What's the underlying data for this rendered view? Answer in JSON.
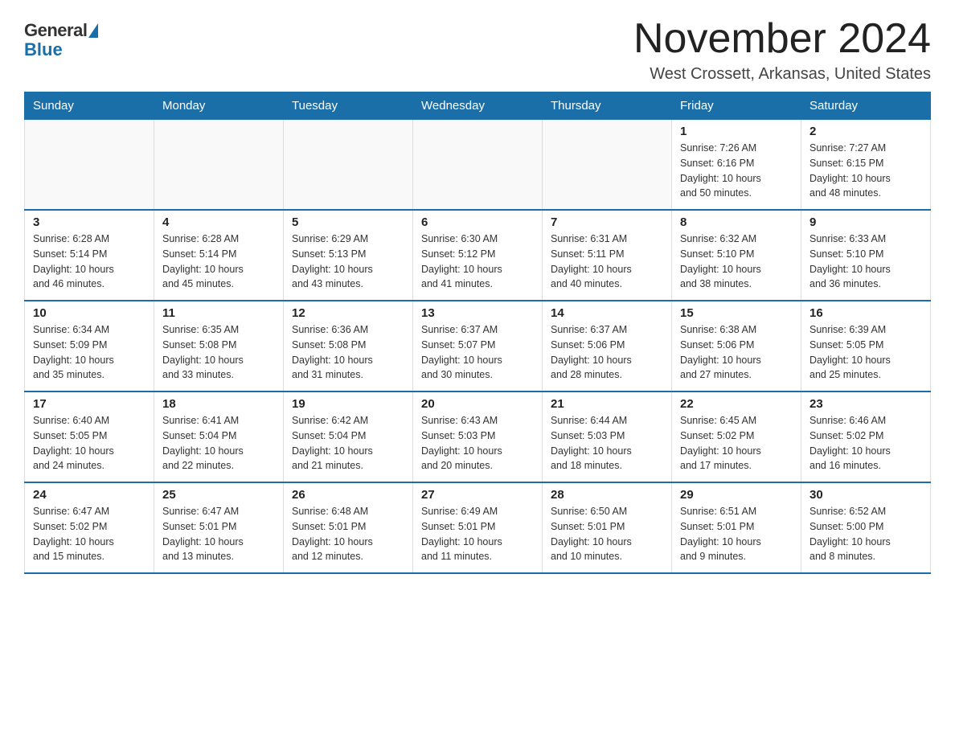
{
  "logo": {
    "general": "General",
    "blue": "Blue"
  },
  "title": "November 2024",
  "location": "West Crossett, Arkansas, United States",
  "days_of_week": [
    "Sunday",
    "Monday",
    "Tuesday",
    "Wednesday",
    "Thursday",
    "Friday",
    "Saturday"
  ],
  "weeks": [
    [
      {
        "day": "",
        "info": ""
      },
      {
        "day": "",
        "info": ""
      },
      {
        "day": "",
        "info": ""
      },
      {
        "day": "",
        "info": ""
      },
      {
        "day": "",
        "info": ""
      },
      {
        "day": "1",
        "info": "Sunrise: 7:26 AM\nSunset: 6:16 PM\nDaylight: 10 hours\nand 50 minutes."
      },
      {
        "day": "2",
        "info": "Sunrise: 7:27 AM\nSunset: 6:15 PM\nDaylight: 10 hours\nand 48 minutes."
      }
    ],
    [
      {
        "day": "3",
        "info": "Sunrise: 6:28 AM\nSunset: 5:14 PM\nDaylight: 10 hours\nand 46 minutes."
      },
      {
        "day": "4",
        "info": "Sunrise: 6:28 AM\nSunset: 5:14 PM\nDaylight: 10 hours\nand 45 minutes."
      },
      {
        "day": "5",
        "info": "Sunrise: 6:29 AM\nSunset: 5:13 PM\nDaylight: 10 hours\nand 43 minutes."
      },
      {
        "day": "6",
        "info": "Sunrise: 6:30 AM\nSunset: 5:12 PM\nDaylight: 10 hours\nand 41 minutes."
      },
      {
        "day": "7",
        "info": "Sunrise: 6:31 AM\nSunset: 5:11 PM\nDaylight: 10 hours\nand 40 minutes."
      },
      {
        "day": "8",
        "info": "Sunrise: 6:32 AM\nSunset: 5:10 PM\nDaylight: 10 hours\nand 38 minutes."
      },
      {
        "day": "9",
        "info": "Sunrise: 6:33 AM\nSunset: 5:10 PM\nDaylight: 10 hours\nand 36 minutes."
      }
    ],
    [
      {
        "day": "10",
        "info": "Sunrise: 6:34 AM\nSunset: 5:09 PM\nDaylight: 10 hours\nand 35 minutes."
      },
      {
        "day": "11",
        "info": "Sunrise: 6:35 AM\nSunset: 5:08 PM\nDaylight: 10 hours\nand 33 minutes."
      },
      {
        "day": "12",
        "info": "Sunrise: 6:36 AM\nSunset: 5:08 PM\nDaylight: 10 hours\nand 31 minutes."
      },
      {
        "day": "13",
        "info": "Sunrise: 6:37 AM\nSunset: 5:07 PM\nDaylight: 10 hours\nand 30 minutes."
      },
      {
        "day": "14",
        "info": "Sunrise: 6:37 AM\nSunset: 5:06 PM\nDaylight: 10 hours\nand 28 minutes."
      },
      {
        "day": "15",
        "info": "Sunrise: 6:38 AM\nSunset: 5:06 PM\nDaylight: 10 hours\nand 27 minutes."
      },
      {
        "day": "16",
        "info": "Sunrise: 6:39 AM\nSunset: 5:05 PM\nDaylight: 10 hours\nand 25 minutes."
      }
    ],
    [
      {
        "day": "17",
        "info": "Sunrise: 6:40 AM\nSunset: 5:05 PM\nDaylight: 10 hours\nand 24 minutes."
      },
      {
        "day": "18",
        "info": "Sunrise: 6:41 AM\nSunset: 5:04 PM\nDaylight: 10 hours\nand 22 minutes."
      },
      {
        "day": "19",
        "info": "Sunrise: 6:42 AM\nSunset: 5:04 PM\nDaylight: 10 hours\nand 21 minutes."
      },
      {
        "day": "20",
        "info": "Sunrise: 6:43 AM\nSunset: 5:03 PM\nDaylight: 10 hours\nand 20 minutes."
      },
      {
        "day": "21",
        "info": "Sunrise: 6:44 AM\nSunset: 5:03 PM\nDaylight: 10 hours\nand 18 minutes."
      },
      {
        "day": "22",
        "info": "Sunrise: 6:45 AM\nSunset: 5:02 PM\nDaylight: 10 hours\nand 17 minutes."
      },
      {
        "day": "23",
        "info": "Sunrise: 6:46 AM\nSunset: 5:02 PM\nDaylight: 10 hours\nand 16 minutes."
      }
    ],
    [
      {
        "day": "24",
        "info": "Sunrise: 6:47 AM\nSunset: 5:02 PM\nDaylight: 10 hours\nand 15 minutes."
      },
      {
        "day": "25",
        "info": "Sunrise: 6:47 AM\nSunset: 5:01 PM\nDaylight: 10 hours\nand 13 minutes."
      },
      {
        "day": "26",
        "info": "Sunrise: 6:48 AM\nSunset: 5:01 PM\nDaylight: 10 hours\nand 12 minutes."
      },
      {
        "day": "27",
        "info": "Sunrise: 6:49 AM\nSunset: 5:01 PM\nDaylight: 10 hours\nand 11 minutes."
      },
      {
        "day": "28",
        "info": "Sunrise: 6:50 AM\nSunset: 5:01 PM\nDaylight: 10 hours\nand 10 minutes."
      },
      {
        "day": "29",
        "info": "Sunrise: 6:51 AM\nSunset: 5:01 PM\nDaylight: 10 hours\nand 9 minutes."
      },
      {
        "day": "30",
        "info": "Sunrise: 6:52 AM\nSunset: 5:00 PM\nDaylight: 10 hours\nand 8 minutes."
      }
    ]
  ]
}
